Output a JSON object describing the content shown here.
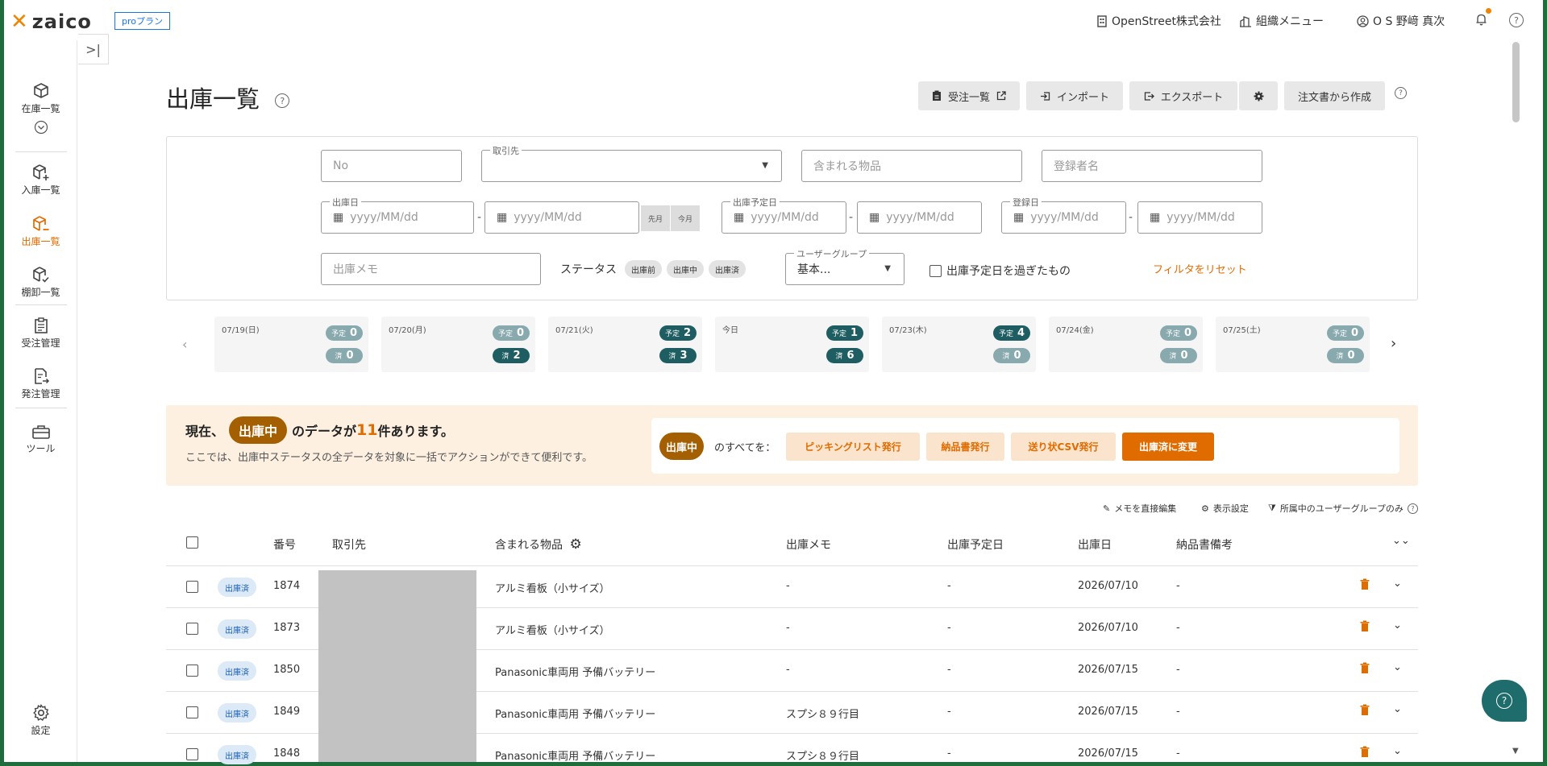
{
  "header": {
    "logo": "zaico",
    "plan_badge": "proプラン",
    "company": "OpenStreet株式会社",
    "org_menu": "組織メニュー",
    "user": "O S 野﨑 真次"
  },
  "sidebar": {
    "items": [
      {
        "label": "在庫一覧",
        "icon": "box-icon"
      },
      {
        "label": "入庫一覧",
        "icon": "box-plus-icon"
      },
      {
        "label": "出庫一覧",
        "icon": "box-minus-icon"
      },
      {
        "label": "棚卸一覧",
        "icon": "box-check-icon"
      },
      {
        "label": "受注管理",
        "icon": "clipboard-icon"
      },
      {
        "label": "発注管理",
        "icon": "document-arrow-icon"
      },
      {
        "label": "ツール",
        "icon": "toolbox-icon"
      },
      {
        "label": "設定",
        "icon": "gear-icon"
      }
    ],
    "active_index": 2
  },
  "page": {
    "title": "出庫一覧",
    "toolbar": {
      "orders_list": "受注一覧",
      "import": "インポート",
      "export": "エクスポート",
      "create_from_order": "注文書から作成"
    }
  },
  "filters": {
    "no_placeholder": "No",
    "customer_label": "取引先",
    "items_placeholder": "含まれる物品",
    "registrant_placeholder": "登録者名",
    "ship_date_label": "出庫日",
    "planned_date_label": "出庫予定日",
    "registered_date_label": "登録日",
    "date_placeholder": "yyyy/MM/dd",
    "last_month": "先月",
    "this_month": "今月",
    "memo_placeholder": "出庫メモ",
    "status_label": "ステータス",
    "status_options": [
      "出庫前",
      "出庫中",
      "出庫済"
    ],
    "user_group_label": "ユーザーグループ",
    "user_group_value": "基本...",
    "overdue_label": "出庫予定日を過ぎたもの",
    "reset": "フィルタをリセット"
  },
  "calendar": {
    "planned_label": "予定",
    "done_label": "済",
    "days": [
      {
        "date": "07/19(日)",
        "planned": 0,
        "done": 0
      },
      {
        "date": "07/20(月)",
        "planned": 0,
        "done": 2
      },
      {
        "date": "07/21(火)",
        "planned": 2,
        "done": 3
      },
      {
        "date": "今日",
        "planned": 1,
        "done": 6
      },
      {
        "date": "07/23(木)",
        "planned": 4,
        "done": 0
      },
      {
        "date": "07/24(金)",
        "planned": 0,
        "done": 0
      },
      {
        "date": "07/25(土)",
        "planned": 0,
        "done": 0
      }
    ]
  },
  "banner": {
    "prefix": "現在、",
    "status": "出庫中",
    "middle": "のデータが",
    "count": "11",
    "suffix": "件あります。",
    "sub": "ここでは、出庫中ステータスの全データを対象に一括でアクションができて便利です。",
    "all_of": "のすべてを：",
    "actions": [
      "ピッキングリスト発行",
      "納品書発行",
      "送り状CSV発行",
      "出庫済に変更"
    ]
  },
  "table_tools": {
    "edit_memo": "メモを直接編集",
    "display_settings": "表示設定",
    "own_group_only": "所属中のユーザーグループのみ"
  },
  "table": {
    "columns": [
      "番号",
      "取引先",
      "含まれる物品",
      "出庫メモ",
      "出庫予定日",
      "出庫日",
      "納品書備考"
    ],
    "rows": [
      {
        "status": "出庫済",
        "no": "1874",
        "item": "アルミ看板（小サイズ）",
        "memo": "-",
        "planned": "-",
        "date": "2026/07/10",
        "note": "-"
      },
      {
        "status": "出庫済",
        "no": "1873",
        "item": "アルミ看板（小サイズ）",
        "memo": "-",
        "planned": "-",
        "date": "2026/07/10",
        "note": "-"
      },
      {
        "status": "出庫済",
        "no": "1850",
        "item": "Panasonic車両用 予備バッテリー",
        "memo": "-",
        "planned": "-",
        "date": "2026/07/15",
        "note": "-"
      },
      {
        "status": "出庫済",
        "no": "1849",
        "item": "Panasonic車両用 予備バッテリー",
        "memo": "スプシ８９行目",
        "planned": "-",
        "date": "2026/07/15",
        "note": "-"
      },
      {
        "status": "出庫済",
        "no": "1848",
        "item": "Panasonic車両用 予備バッテリー",
        "memo": "スプシ８９行目",
        "planned": "-",
        "date": "2026/07/15",
        "note": "-"
      }
    ]
  },
  "colors": {
    "accent": "#e06c00",
    "dark_teal": "#1e5d62",
    "frame_green": "#1e6d3c"
  }
}
